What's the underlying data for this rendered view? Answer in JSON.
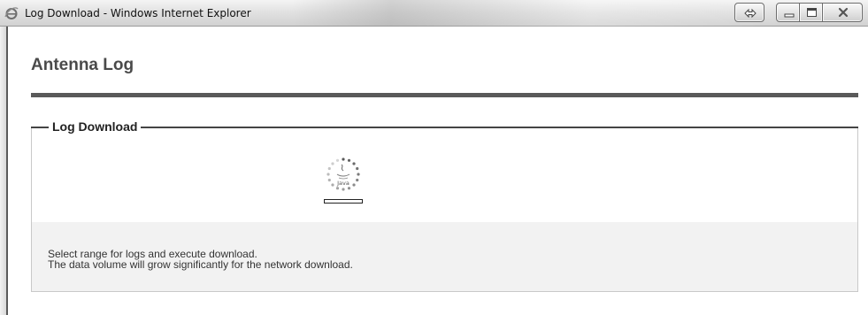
{
  "window": {
    "title": "Log Download - Windows Internet Explorer",
    "controls": {
      "restore_icon": "double-arrow-icon",
      "minimize_icon": "minimize-icon",
      "maximize_icon": "maximize-icon",
      "close_icon": "close-icon"
    }
  },
  "page": {
    "title": "Antenna Log"
  },
  "section": {
    "legend": "Log Download",
    "loader_label": "Java",
    "loader_icon": "java-loading-icon"
  },
  "info": {
    "line1": "Select range for logs and execute download.",
    "line2": "The data volume will grow significantly for the network download."
  },
  "colors": {
    "title_rule": "#5a5a5a",
    "info_background": "#f2f2f2"
  }
}
